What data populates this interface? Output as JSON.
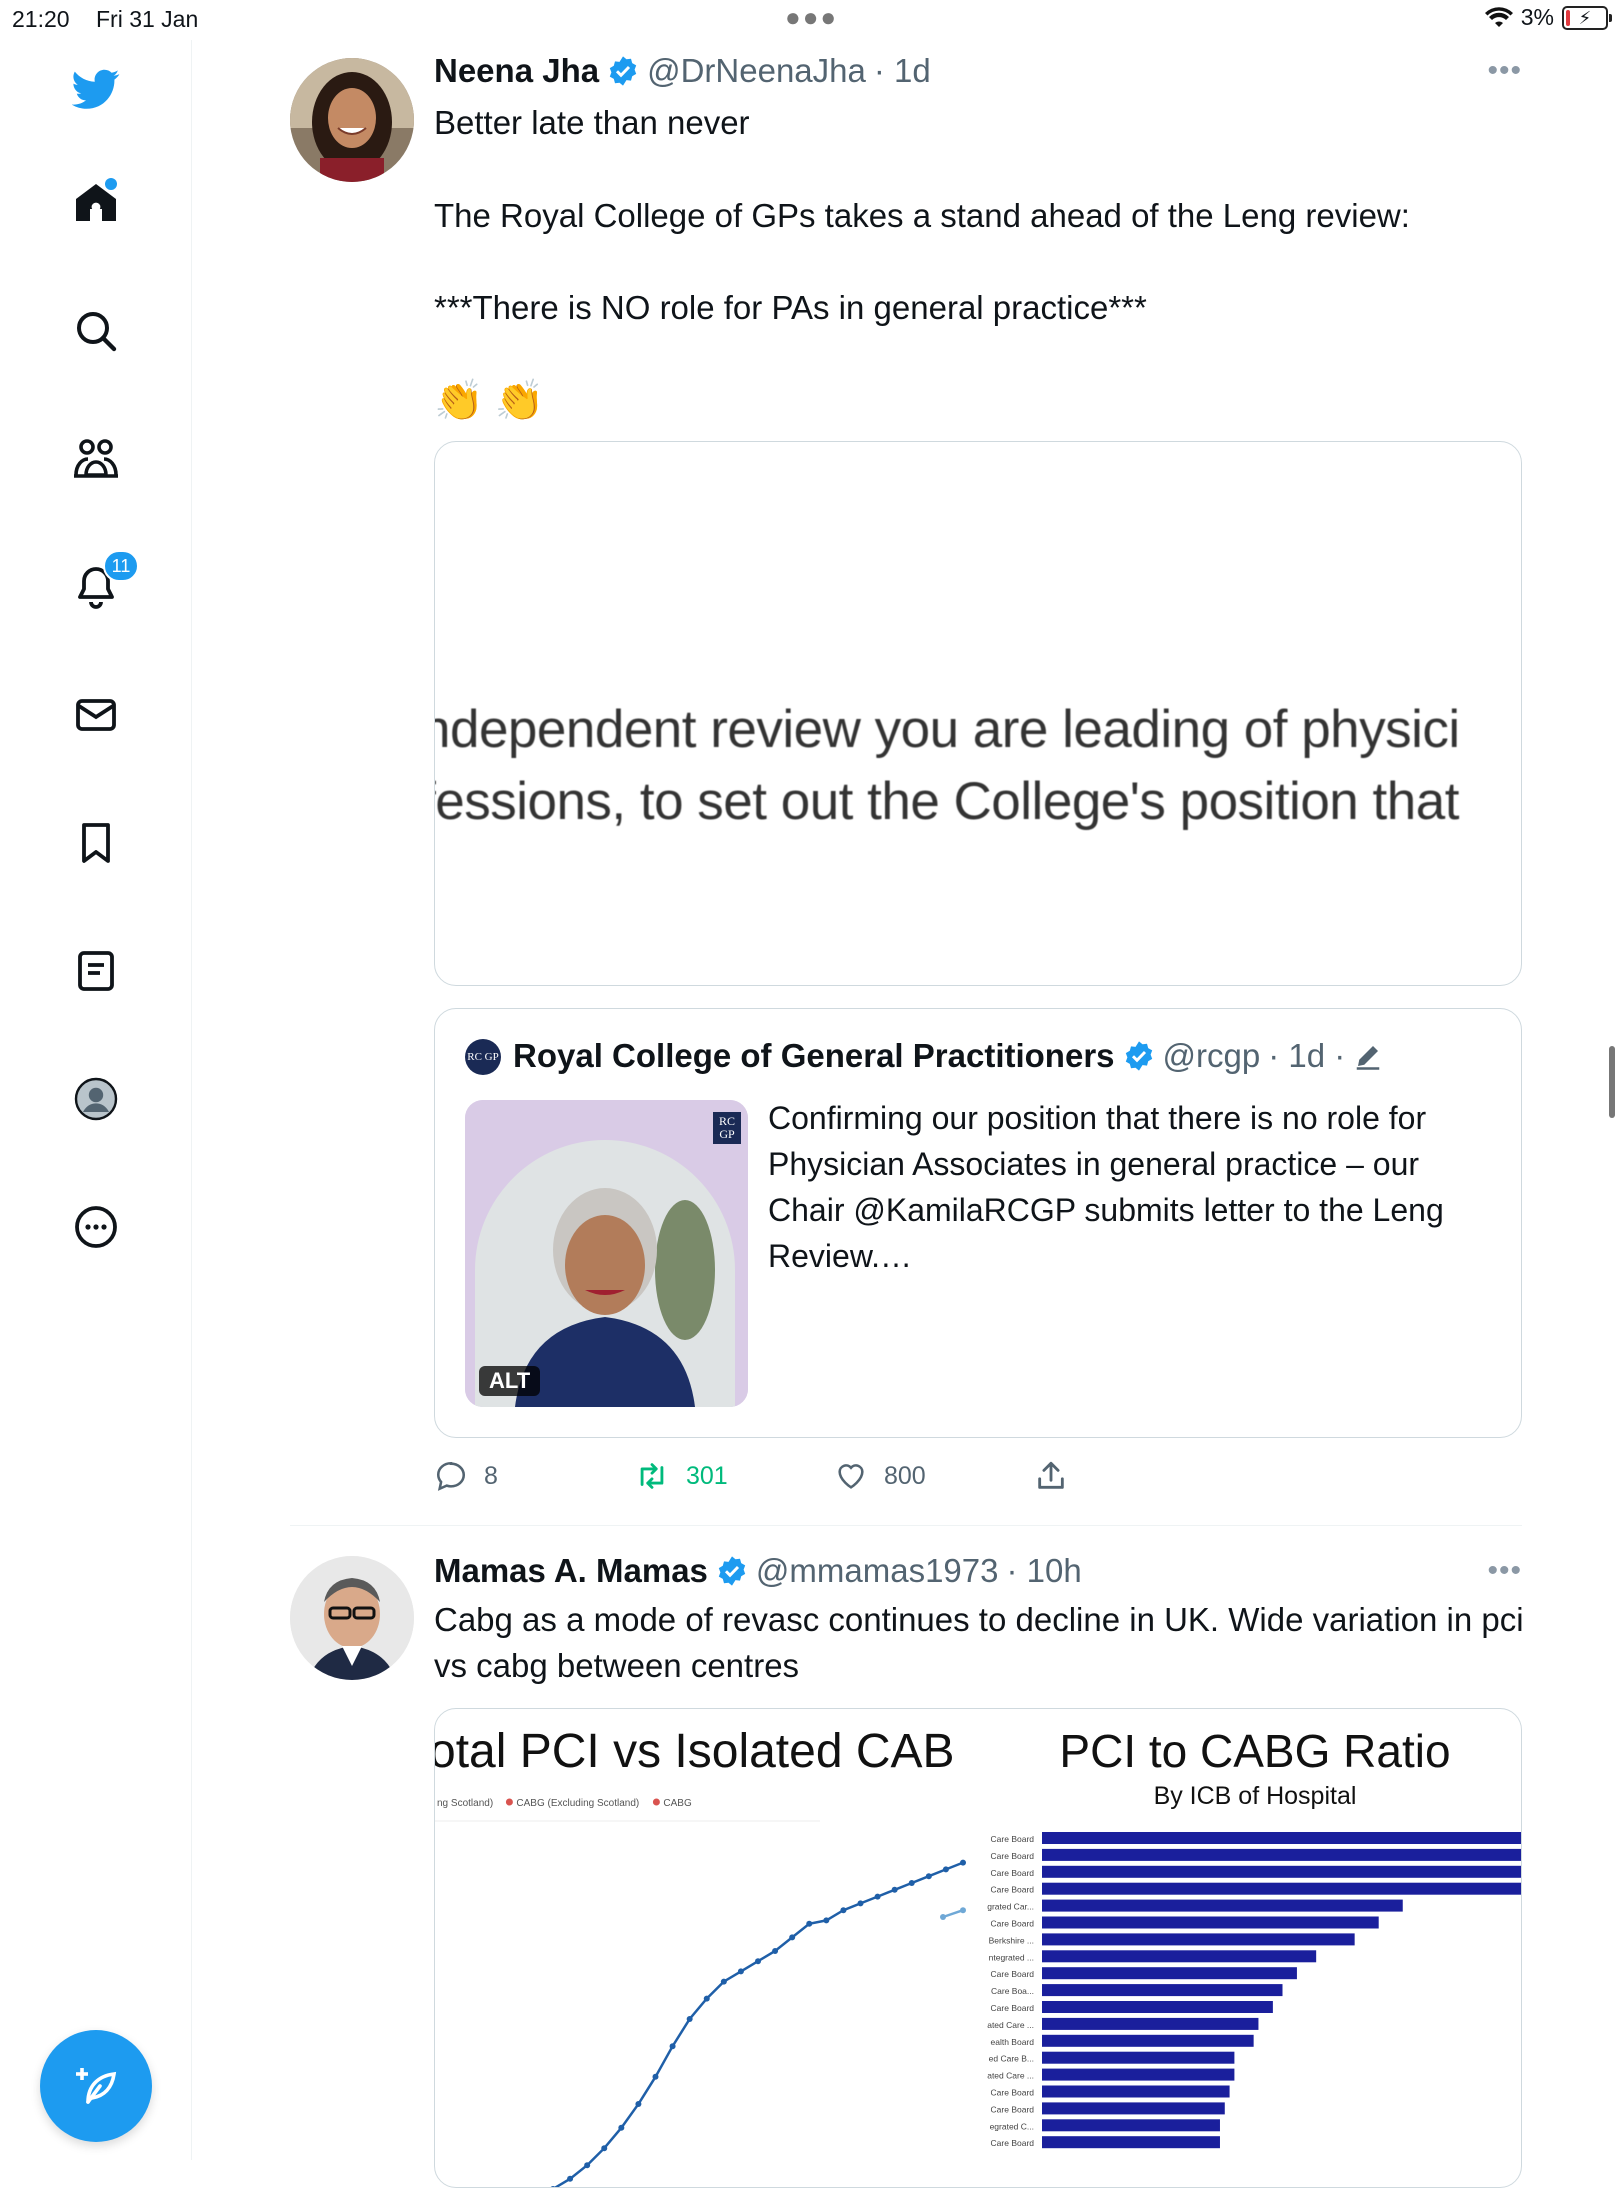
{
  "status_bar": {
    "time": "21:20",
    "date": "Fri 31 Jan",
    "battery": "3%"
  },
  "sidebar": {
    "items": [
      {
        "name": "twitter-logo"
      },
      {
        "name": "home"
      },
      {
        "name": "search"
      },
      {
        "name": "communities"
      },
      {
        "name": "notifications",
        "badge": "11"
      },
      {
        "name": "messages"
      },
      {
        "name": "bookmarks"
      },
      {
        "name": "lists"
      },
      {
        "name": "profile"
      },
      {
        "name": "more"
      }
    ]
  },
  "tweets": [
    {
      "author": "Neena Jha",
      "handle": "@DrNeenaJha",
      "time": "· 1d",
      "lines": [
        "Better late than never",
        "The Royal College of GPs takes a stand ahead of the Leng review:",
        "***There is NO role for PAs in general practice***",
        "👏 👏"
      ],
      "media_text": [
        "ndependent review you are leading of physici",
        "fessions, to set out the College's position that"
      ],
      "quote": {
        "org_logo": "RC GP",
        "author": "Royal College of General Practitioners",
        "handle": "@rcgp",
        "time": "· 1d ·",
        "image_alt_badge": "ALT",
        "image_logo": "RC GP",
        "text": "Confirming our position that there is no role for Physician Associates in general practice – our Chair @KamilaRCGP submits letter to the Leng Review.…"
      },
      "stats": {
        "replies": "8",
        "retweets": "301",
        "likes": "800"
      }
    },
    {
      "author": "Mamas A. Mamas",
      "handle": "@mmamas1973",
      "time": "· 10h",
      "text": "Cabg as a mode of revasc continues to decline in UK. Wide variation in pci vs cabg between centres",
      "chart_data": [
        {
          "type": "line",
          "title": "otal PCI vs Isolated CAB",
          "legend": [
            "ng Scotland)",
            "CABG (Excluding Scotland)",
            "CABG"
          ],
          "legend_colors": [
            "#d9534f",
            "#d9534f",
            "#d9534f"
          ],
          "series": [
            {
              "name": "",
              "color": "#1f5fa8",
              "values": [
                0.0,
                0.03,
                0.07,
                0.12,
                0.18,
                0.25,
                0.33,
                0.42,
                0.5,
                0.56,
                0.61,
                0.64,
                0.67,
                0.7,
                0.74,
                0.78,
                0.79,
                0.82,
                0.84,
                0.86,
                0.88,
                0.9,
                0.92,
                0.94,
                0.96
              ]
            },
            {
              "name": "",
              "color": "#6fa8d6",
              "values": [
                0.8,
                0.82
              ]
            }
          ]
        },
        {
          "type": "bar",
          "title": "PCI to CABG Ratio",
          "subtitle": "By ICB of Hospital",
          "categories": [
            "Care Board",
            "Care Board",
            "Care Board",
            "Care Board",
            "grated Car...",
            "Care Board",
            "Berkshire ...",
            "ntegrated ...",
            "Care Board",
            "Care Boa...",
            "Care Board",
            "ated Care ...",
            "ealth Board",
            "ed Care B...",
            "ated Care ...",
            "Care Board",
            "Care Board",
            "egrated C...",
            "Care Board"
          ],
          "values": [
            1.0,
            1.0,
            1.0,
            1.0,
            0.75,
            0.7,
            0.65,
            0.57,
            0.53,
            0.5,
            0.48,
            0.45,
            0.44,
            0.4,
            0.4,
            0.39,
            0.38,
            0.37,
            0.37
          ],
          "color": "#1a1f9c"
        }
      ]
    }
  ]
}
